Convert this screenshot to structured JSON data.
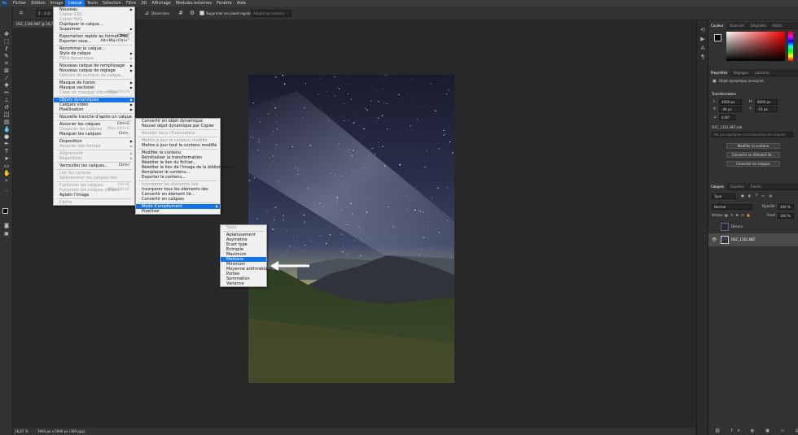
{
  "menubar": {
    "logo": "Ps",
    "items": [
      "Fichier",
      "Edition",
      "Image",
      "Calque",
      "Texte",
      "Sélection",
      "Filtre",
      "3D",
      "Affichage",
      "Modules externes",
      "Fenêtre",
      "Aide"
    ],
    "active_index": 3
  },
  "options_bar": {
    "ratio_value": "2 : 3 (4 : 6)",
    "width_value": "2",
    "height_value": "3",
    "clear_label": "Effacer",
    "straighten_label": "Désincliner",
    "delete_pixels_label": "Supprimer les pixels rognés",
    "content_aware_label": "Adapté au contenu",
    "delete_pixels_checked": true
  },
  "document_tab": {
    "label": "DSC_1166.NEF @ 16,7% (Objet dynamique, RVB/8)"
  },
  "status_bar": {
    "zoom": "16,67 %",
    "doc_info": "3964 px x 5946 px (300 ppp)"
  },
  "calque_menu": {
    "items": [
      {
        "label": "Nouveau",
        "arrow": true
      },
      {
        "label": "Copier CSS",
        "disabled": true
      },
      {
        "label": "Copier SVG",
        "disabled": true
      },
      {
        "label": "Dupliquer le calque..."
      },
      {
        "label": "Supprimer",
        "arrow": true
      },
      {
        "sep": true
      },
      {
        "label": "Exportation rapide au format PNG",
        "shortcut": "Ctrl+\""
      },
      {
        "label": "Exporter sous...",
        "shortcut": "Alt+Maj+Ctrl+\""
      },
      {
        "sep": true
      },
      {
        "label": "Renommer le calque..."
      },
      {
        "label": "Style de calque",
        "arrow": true
      },
      {
        "label": "Filtre dynamique",
        "disabled": true,
        "arrow": true
      },
      {
        "sep": true
      },
      {
        "label": "Nouveau calque de remplissage",
        "arrow": true
      },
      {
        "label": "Nouveau calque de réglage",
        "arrow": true
      },
      {
        "label": "Options de contenu de calque...",
        "disabled": true
      },
      {
        "sep": true
      },
      {
        "label": "Masque de fusion",
        "arrow": true
      },
      {
        "label": "Masque vectoriel",
        "arrow": true
      },
      {
        "label": "Créer un masque d'écrêtage",
        "shortcut": "Alt+Ctrl+G",
        "disabled": true
      },
      {
        "sep": true
      },
      {
        "label": "Objets dynamiques",
        "arrow": true,
        "highlight": true
      },
      {
        "label": "Calques vidéo",
        "arrow": true
      },
      {
        "label": "Pixellisation",
        "arrow": true
      },
      {
        "sep": true
      },
      {
        "label": "Nouvelle tranche d'après un calque"
      },
      {
        "sep": true
      },
      {
        "label": "Associer les calques",
        "shortcut": "Ctrl+G"
      },
      {
        "label": "Dissocier les calques",
        "shortcut": "Maj+Ctrl+G",
        "disabled": true
      },
      {
        "label": "Masquer les calques",
        "shortcut": "Ctrl+,"
      },
      {
        "sep": true
      },
      {
        "label": "Disposition",
        "arrow": true
      },
      {
        "label": "Associer des formes",
        "arrow": true,
        "disabled": true
      },
      {
        "sep": true
      },
      {
        "label": "Alignement",
        "arrow": true,
        "disabled": true
      },
      {
        "label": "Répartition",
        "arrow": true,
        "disabled": true
      },
      {
        "sep": true
      },
      {
        "label": "Verrouiller les calques...",
        "shortcut": "Ctrl+/"
      },
      {
        "sep": true
      },
      {
        "label": "Lier les calques",
        "disabled": true
      },
      {
        "label": "Sélectionner les calques liés",
        "disabled": true
      },
      {
        "sep": true
      },
      {
        "label": "Fusionner les calques",
        "shortcut": "Ctrl+E",
        "disabled": true
      },
      {
        "label": "Fusionner les calques visibles",
        "shortcut": "Maj+Ctrl+E",
        "disabled": true
      },
      {
        "label": "Aplatir l'image"
      },
      {
        "sep": true
      },
      {
        "label": "Cache",
        "disabled": true
      }
    ]
  },
  "smart_objects_menu": {
    "items": [
      {
        "label": "Convertir en objet dynamique"
      },
      {
        "label": "Nouvel objet dynamique par Copier"
      },
      {
        "sep": true
      },
      {
        "label": "Révéler dans l'Explorateur",
        "disabled": true
      },
      {
        "sep": true
      },
      {
        "label": "Mettre à jour le contenu modifié",
        "disabled": true
      },
      {
        "label": "Mettre à jour tout le contenu modifié"
      },
      {
        "sep": true
      },
      {
        "label": "Modifier le contenu"
      },
      {
        "label": "Réinitialiser la transformation"
      },
      {
        "label": "Rééditer le lien du fichier..."
      },
      {
        "label": "Rééditer le lien de l'image de la bibliothèque..."
      },
      {
        "label": "Remplacer le contenu..."
      },
      {
        "label": "Exporter le contenu..."
      },
      {
        "sep": true
      },
      {
        "label": "Incorporer les éléments liés",
        "disabled": true
      },
      {
        "label": "Incorporer tous les éléments liés"
      },
      {
        "label": "Convertir en élément lié..."
      },
      {
        "label": "Convertir en calques"
      },
      {
        "sep": true
      },
      {
        "label": "Mode d'empilement",
        "arrow": true,
        "highlight": true
      },
      {
        "label": "Pixelliser"
      }
    ]
  },
  "stack_mode_menu": {
    "items": [
      {
        "label": "Sans",
        "disabled": true
      },
      {
        "sep": true
      },
      {
        "label": "Aplatissement"
      },
      {
        "label": "Asymétrie"
      },
      {
        "label": "Ecart type"
      },
      {
        "label": "Entropie"
      },
      {
        "label": "Maximum"
      },
      {
        "label": "Médiane",
        "highlight": true
      },
      {
        "label": "Minimum"
      },
      {
        "label": "Moyenne arithmétique"
      },
      {
        "label": "Portée"
      },
      {
        "label": "Sommation"
      },
      {
        "label": "Variance"
      }
    ]
  },
  "color_panel": {
    "tabs": [
      "Couleur",
      "Nuancier",
      "Dégradés",
      "Motifs"
    ],
    "active_tab": 0,
    "hue": "#ff0000"
  },
  "properties_panel": {
    "tabs": [
      "Propriétés",
      "Réglages",
      "Librairies"
    ],
    "active_tab": 0,
    "object_type": "Objet dynamique incorporé",
    "transform_title": "Transformation",
    "w_label": "L :",
    "w_value": "4000 px",
    "h_label": "H :",
    "h_value": "6000 px",
    "x_label": "X :",
    "x_value": "-46 px",
    "y_label": "Y :",
    "y_value": "-53 px",
    "angle_label": "⊿ :",
    "angle_value": "0,00°",
    "file_name": "DSC_1161.NEF.psb",
    "comp_placeholder": "Ne pas appliquer la composition de calques",
    "edit_button": "Modifier le contenu",
    "linked_button": "Convertir en élément lié...",
    "layers_button": "Convertir en calques"
  },
  "layers_panel": {
    "tabs": [
      "Calques",
      "Couches",
      "Tracés"
    ],
    "active_tab": 0,
    "filter_label": "Type",
    "blend_mode": "Normal",
    "opacity_label": "Opacité :",
    "opacity_value": "100 %",
    "lock_label": "Verrou :",
    "fill_label": "Fond :",
    "fill_value": "100 %",
    "layers": [
      {
        "name": "Décors",
        "visible": false,
        "selected": false
      },
      {
        "name": "DSC_1161.NEF",
        "visible": true,
        "selected": true
      }
    ]
  },
  "colors": {
    "accent": "#1473e6",
    "ps_blue": "#31a8ff"
  }
}
